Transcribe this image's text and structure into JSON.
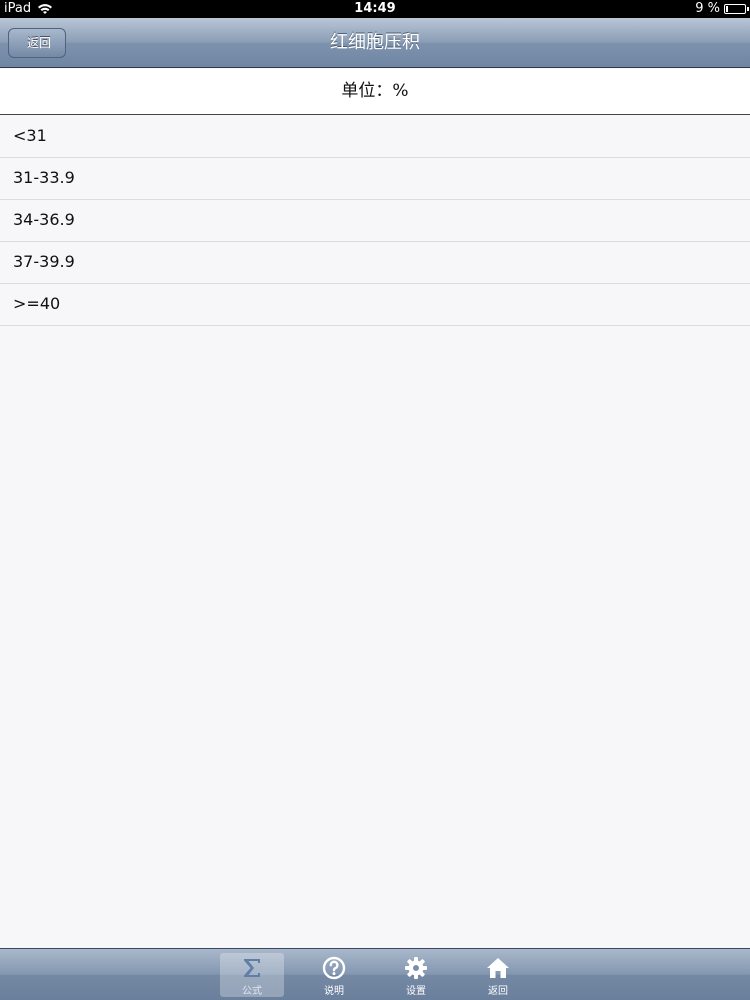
{
  "status_bar": {
    "carrier": "iPad",
    "time": "14:49",
    "battery": "9 %",
    "battery_level": 0.09
  },
  "nav": {
    "title": "红细胞压积",
    "back_label": "返回"
  },
  "unit_header": "单位：%",
  "items": [
    {
      "label": "<31"
    },
    {
      "label": "31-33.9"
    },
    {
      "label": "34-36.9"
    },
    {
      "label": "37-39.9"
    },
    {
      "label": ">=40"
    }
  ],
  "tabs": [
    {
      "label": "公式",
      "icon": "sigma-icon",
      "active": true
    },
    {
      "label": "说明",
      "icon": "question-icon",
      "active": false
    },
    {
      "label": "设置",
      "icon": "gear-icon",
      "active": false
    },
    {
      "label": "返回",
      "icon": "home-icon",
      "active": false
    }
  ]
}
